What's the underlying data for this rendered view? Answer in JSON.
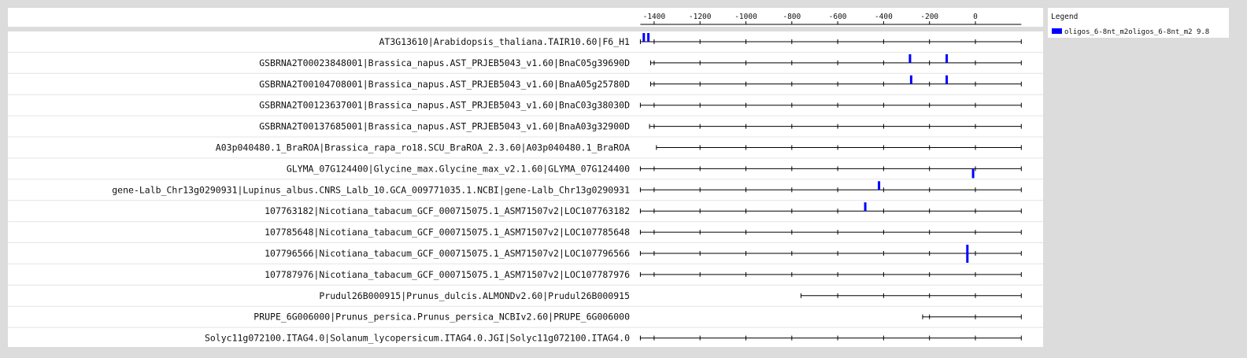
{
  "chart_data": {
    "type": "sequence-track",
    "xlim": [
      -1460,
      200
    ],
    "axis_ticks": [
      -1400,
      -1200,
      -1000,
      -800,
      -600,
      -400,
      -200,
      0
    ],
    "axis_tick_labels": [
      "-1400",
      "-1200",
      "-1000",
      "-800",
      "-600",
      "-400",
      "-200",
      "0"
    ],
    "legend": {
      "title": "Legend",
      "entries": [
        {
          "label": "oligos_6-8nt_m2oligos_6-8nt_m2 9.8",
          "color": "#0000ff"
        }
      ]
    },
    "tracks": [
      {
        "label": "AT3G13610|Arabidopsis_thaliana.TAIR10.60|F6_H1",
        "start": -1460,
        "end": 200,
        "motifs": [
          {
            "pos": -1445,
            "strand": "+"
          },
          {
            "pos": -1425,
            "strand": "+"
          }
        ]
      },
      {
        "label": "GSBRNA2T00023848001|Brassica_napus.AST_PRJEB5043_v1.60|BnaC05g39690D",
        "start": -1415,
        "end": 200,
        "motifs": [
          {
            "pos": -285,
            "strand": "+"
          },
          {
            "pos": -125,
            "strand": "+"
          }
        ]
      },
      {
        "label": "GSBRNA2T00104708001|Brassica_napus.AST_PRJEB5043_v1.60|BnaA05g25780D",
        "start": -1415,
        "end": 200,
        "motifs": [
          {
            "pos": -280,
            "strand": "+"
          },
          {
            "pos": -125,
            "strand": "+"
          }
        ]
      },
      {
        "label": "GSBRNA2T00123637001|Brassica_napus.AST_PRJEB5043_v1.60|BnaC03g38030D",
        "start": -1460,
        "end": 200,
        "motifs": []
      },
      {
        "label": "GSBRNA2T00137685001|Brassica_napus.AST_PRJEB5043_v1.60|BnaA03g32900D",
        "start": -1420,
        "end": 200,
        "motifs": []
      },
      {
        "label": "A03p040480.1_BraROA|Brassica_rapa_ro18.SCU_BraROA_2.3.60|A03p040480.1_BraROA",
        "start": -1390,
        "end": 200,
        "motifs": []
      },
      {
        "label": "GLYMA_07G124400|Glycine_max.Glycine_max_v2.1.60|GLYMA_07G124400",
        "start": -1460,
        "end": 200,
        "motifs": [
          {
            "pos": -10,
            "strand": "-"
          }
        ]
      },
      {
        "label": "gene-Lalb_Chr13g0290931|Lupinus_albus.CNRS_Lalb_10.GCA_009771035.1.NCBI|gene-Lalb_Chr13g0290931",
        "start": -1460,
        "end": 200,
        "motifs": [
          {
            "pos": -420,
            "strand": "+"
          }
        ]
      },
      {
        "label": "107763182|Nicotiana_tabacum_GCF_000715075.1_ASM71507v2|LOC107763182",
        "start": -1460,
        "end": 200,
        "motifs": [
          {
            "pos": -480,
            "strand": "+"
          }
        ]
      },
      {
        "label": "107785648|Nicotiana_tabacum_GCF_000715075.1_ASM71507v2|LOC107785648",
        "start": -1460,
        "end": 200,
        "motifs": []
      },
      {
        "label": "107796566|Nicotiana_tabacum_GCF_000715075.1_ASM71507v2|LOC107796566",
        "start": -1460,
        "end": 200,
        "motifs": [
          {
            "pos": -35,
            "strand": "both"
          }
        ]
      },
      {
        "label": "107787976|Nicotiana_tabacum_GCF_000715075.1_ASM71507v2|LOC107787976",
        "start": -1460,
        "end": 200,
        "motifs": []
      },
      {
        "label": "Prudul26B000915|Prunus_dulcis.ALMONDv2.60|Prudul26B000915",
        "start": -760,
        "end": 200,
        "motifs": []
      },
      {
        "label": "PRUPE_6G006000|Prunus_persica.Prunus_persica_NCBIv2.60|PRUPE_6G006000",
        "start": -230,
        "end": 200,
        "motifs": []
      },
      {
        "label": "Solyc11g072100.ITAG4.0|Solanum_lycopersicum.ITAG4.0.JGI|Solyc11g072100.ITAG4.0",
        "start": -1460,
        "end": 200,
        "motifs": []
      }
    ]
  }
}
